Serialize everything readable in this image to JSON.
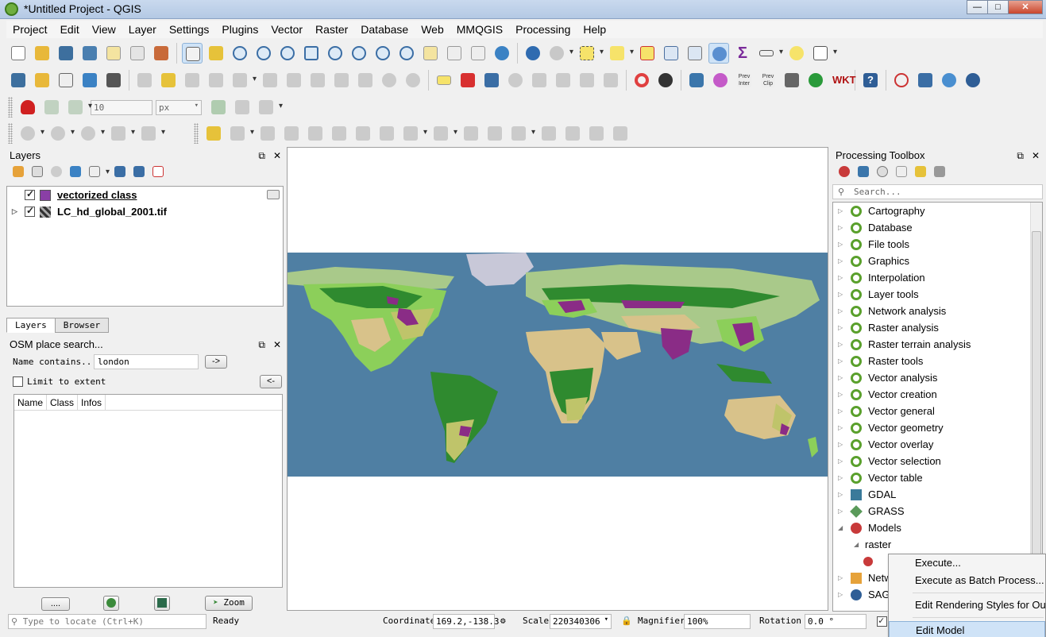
{
  "window": {
    "title": "*Untitled Project - QGIS"
  },
  "menu": [
    "Project",
    "Edit",
    "View",
    "Layer",
    "Settings",
    "Plugins",
    "Vector",
    "Raster",
    "Database",
    "Web",
    "MMQGIS",
    "Processing",
    "Help"
  ],
  "toolbar3": {
    "stroke_width": "10",
    "stroke_unit": "px"
  },
  "layers_panel": {
    "title": "Layers",
    "layers": [
      {
        "name": "vectorized class",
        "visible": true,
        "color": "#8a3fa6"
      },
      {
        "name": "LC_hd_global_2001.tif",
        "visible": true
      }
    ],
    "tabs": [
      "Layers",
      "Browser"
    ]
  },
  "osm_panel": {
    "title": "OSM place search...",
    "name_label": "Name contains...",
    "name_value": "london",
    "go_label": "->",
    "limit_label": "Limit to extent",
    "back_label": "<-",
    "columns": [
      "Name",
      "Class",
      "Infos"
    ],
    "more_label": "....",
    "zoom_label": "Zoom"
  },
  "processing": {
    "title": "Processing Toolbox",
    "search_placeholder": "Search...",
    "groups": [
      "Cartography",
      "Database",
      "File tools",
      "Graphics",
      "Interpolation",
      "Layer tools",
      "Network analysis",
      "Raster analysis",
      "Raster terrain analysis",
      "Raster tools",
      "Vector analysis",
      "Vector creation",
      "Vector general",
      "Vector geometry",
      "Vector overlay",
      "Vector selection",
      "Vector table"
    ],
    "providers": [
      "GDAL",
      "GRASS",
      "Models"
    ],
    "models_child": "raster",
    "after": [
      "Netw",
      "SAG"
    ]
  },
  "context_menu": {
    "items": [
      "Execute...",
      "Execute as Batch Process..."
    ],
    "items2": [
      "Edit Rendering Styles for Ou"
    ],
    "items3": [
      "Edit Model"
    ]
  },
  "status": {
    "locate_placeholder": "Type to locate (Ctrl+K)",
    "ready": "Ready",
    "coordinate_label": "Coordinate",
    "coordinate": "169.2,-138.3",
    "scale_label": "Scale",
    "scale": "220340306",
    "magnifier_label": "Magnifier",
    "magnifier": "100%",
    "rotation_label": "Rotation",
    "rotation": "0.0 °"
  },
  "colors": {
    "ocean": "#4f7fa3",
    "ice": "#c8c8d8",
    "forest": "#2f8a2f",
    "grass": "#8ccf5a",
    "desert": "#d8c28a",
    "urban": "#8a2c86",
    "savanna": "#bfc46a",
    "tundra": "#a9c98a"
  }
}
